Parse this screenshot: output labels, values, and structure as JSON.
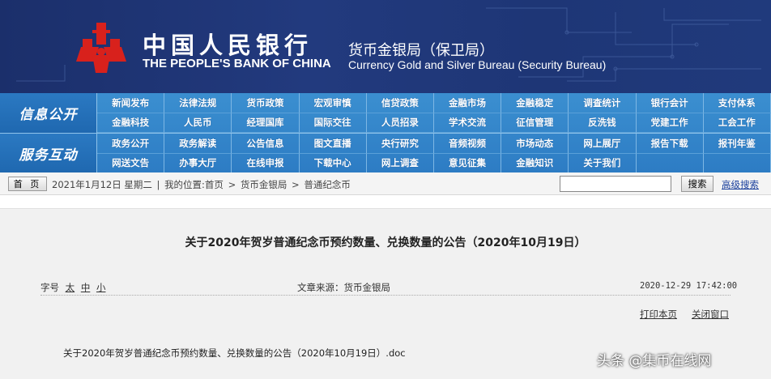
{
  "header": {
    "bank_name_cn": "中国人民银行",
    "bank_name_en": "THE PEOPLE'S BANK OF CHINA",
    "bureau_cn": "货币金银局（保卫局）",
    "bureau_en": "Currency  Gold and Silver Bureau (Security Bureau)",
    "logo_icon": "pboc-logo-icon",
    "bg_color": "#1e3676",
    "logo_color": "#d8211c"
  },
  "nav": {
    "section1_label": "信息公开",
    "section2_label": "服务互动",
    "row1": [
      "新闻发布",
      "法律法规",
      "货币政策",
      "宏观审慎",
      "信贷政策",
      "金融市场",
      "金融稳定",
      "调查统计",
      "银行会计",
      "支付体系"
    ],
    "row2": [
      "金融科技",
      "人民币",
      "经理国库",
      "国际交往",
      "人员招录",
      "学术交流",
      "征信管理",
      "反洗钱",
      "党建工作",
      "工会工作"
    ],
    "row3": [
      "政务公开",
      "政务解读",
      "公告信息",
      "图文直播",
      "央行研究",
      "音频视频",
      "市场动态",
      "网上展厅",
      "报告下载",
      "报刊年鉴"
    ],
    "row4": [
      "网送文告",
      "办事大厅",
      "在线申报",
      "下载中心",
      "网上调查",
      "意见征集",
      "金融知识",
      "关于我们"
    ],
    "color": "#2d7cc4"
  },
  "breadcrumb": {
    "home_label": "首 页",
    "date": "2021年1月12日 星期二",
    "location_label": "我的位置:首页",
    "items": [
      "货币金银局",
      "普通纪念币"
    ],
    "separator": ">",
    "divider": "|",
    "search_button": "搜索",
    "search_value": "",
    "advanced_search": "高级搜索"
  },
  "article": {
    "title": "关于2020年贺岁普通纪念币预约数量、兑换数量的公告（2020年10月19日）",
    "font_size_label": "字号",
    "font_sizes": [
      "太",
      "中",
      "小"
    ],
    "source": "文章来源：货币金银局",
    "datetime": "2020-12-29 17:42:00",
    "print_label": "打印本页",
    "close_label": "关闭窗口",
    "attachment": "关于2020年贺岁普通纪念币预约数量、兑换数量的公告（2020年10月19日）.doc"
  },
  "watermark": "头条 @集币在线网"
}
